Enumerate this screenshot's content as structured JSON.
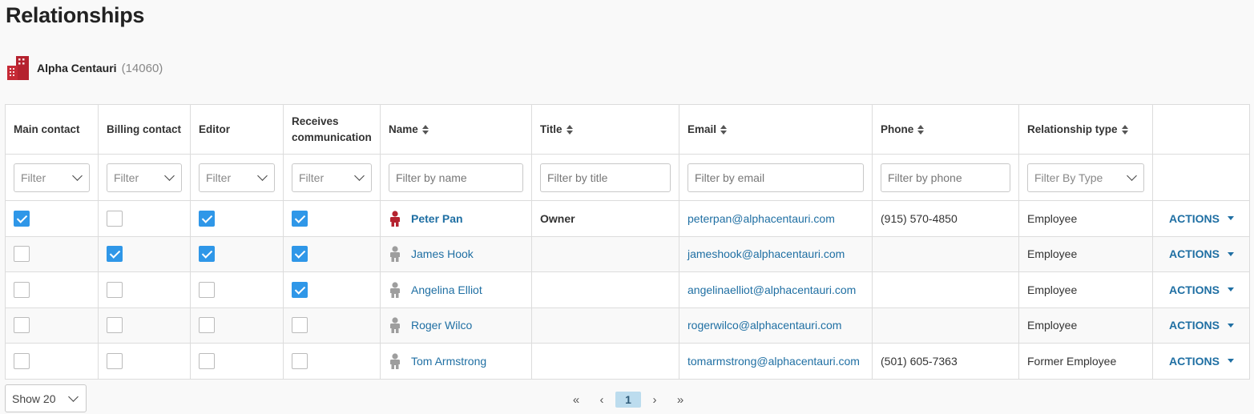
{
  "page": {
    "title": "Relationships"
  },
  "org": {
    "name": "Alpha Centauri",
    "id": "(14060)",
    "icon": "building-icon",
    "color": "#b5222f"
  },
  "columns": {
    "main_contact": "Main contact",
    "billing_contact": "Billing contact",
    "editor": "Editor",
    "receives_communication": "Receives communication",
    "name": "Name",
    "title": "Title",
    "email": "Email",
    "phone": "Phone",
    "relationship_type": "Relationship type"
  },
  "filters": {
    "main_contact": "Filter",
    "billing_contact": "Filter",
    "editor": "Filter",
    "receives_communication": "Filter",
    "name_placeholder": "Filter by name",
    "title_placeholder": "Filter by title",
    "email_placeholder": "Filter by email",
    "phone_placeholder": "Filter by phone",
    "type": "Filter By Type"
  },
  "rows": [
    {
      "main": true,
      "billing": false,
      "editor": true,
      "receives": true,
      "name": "Peter Pan",
      "primary": true,
      "title": "Owner",
      "email": "peterpan@alphacentauri.com",
      "phone": "(915) 570-4850",
      "type": "Employee",
      "actions": "ACTIONS"
    },
    {
      "main": false,
      "billing": true,
      "editor": true,
      "receives": true,
      "name": "James Hook",
      "primary": false,
      "title": "",
      "email": "jameshook@alphacentauri.com",
      "phone": "",
      "type": "Employee",
      "actions": "ACTIONS"
    },
    {
      "main": false,
      "billing": false,
      "editor": false,
      "receives": true,
      "name": "Angelina Elliot",
      "primary": false,
      "title": "",
      "email": "angelinaelliot@alphacentauri.com",
      "phone": "",
      "type": "Employee",
      "actions": "ACTIONS"
    },
    {
      "main": false,
      "billing": false,
      "editor": false,
      "receives": false,
      "name": "Roger Wilco",
      "primary": false,
      "title": "",
      "email": "rogerwilco@alphacentauri.com",
      "phone": "",
      "type": "Employee",
      "actions": "ACTIONS"
    },
    {
      "main": false,
      "billing": false,
      "editor": false,
      "receives": false,
      "name": "Tom Armstrong",
      "primary": false,
      "title": "",
      "email": "tomarmstrong@alphacentauri.com",
      "phone": "(501) 605-7363",
      "type": "Former Employee",
      "actions": "ACTIONS"
    }
  ],
  "pagination": {
    "page_size": "Show 20",
    "first": "«",
    "prev": "‹",
    "current": "1",
    "next": "›",
    "last": "»"
  },
  "colors": {
    "accent": "#2f97e8",
    "link": "#1f6fa3",
    "primary_person": "#b5222f",
    "person": "#9e9e9e"
  }
}
